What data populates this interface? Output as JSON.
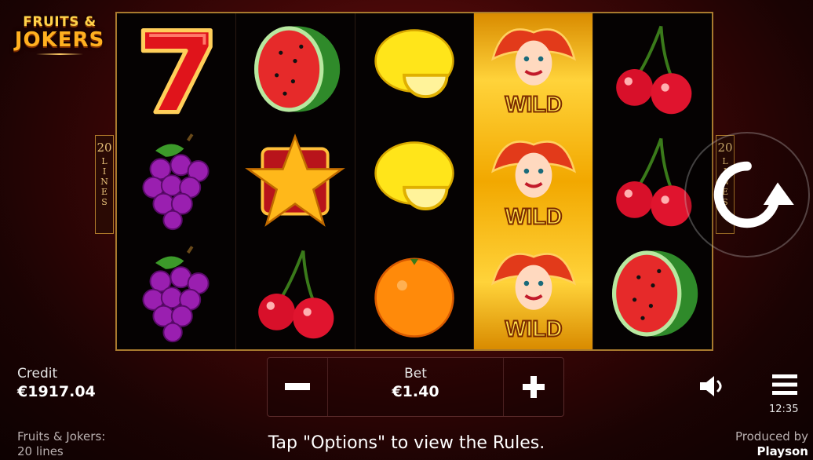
{
  "logo": {
    "line1": "FRUITS &",
    "line2": "JOKERS"
  },
  "paylines": {
    "count": "20",
    "label": [
      "L",
      "I",
      "N",
      "E",
      "S"
    ]
  },
  "reels": [
    [
      "seven",
      "watermelon-half",
      "",
      "",
      ""
    ],
    [
      "grapes",
      "star",
      "",
      ""
    ],
    [
      "grapes",
      "cherry",
      ""
    ]
  ],
  "reel_columns": [
    {
      "symbols": [
        "seven-icon",
        "grapes-icon",
        "grapes-icon"
      ]
    },
    {
      "symbols": [
        "watermelon-icon",
        "star-icon",
        "cherry-icon"
      ]
    },
    {
      "symbols": [
        "lemon-icon",
        "lemon-icon",
        "orange-icon"
      ]
    },
    {
      "symbols": [
        "joker-wild-icon",
        "joker-wild-icon",
        "joker-wild-icon"
      ],
      "wild_label": "WILD"
    },
    {
      "symbols": [
        "cherry-icon",
        "cherry-icon",
        "watermelon-icon"
      ]
    }
  ],
  "credit": {
    "label": "Credit",
    "value": "€1917.04"
  },
  "bet": {
    "label": "Bet",
    "value": "€1.40",
    "minus": "−",
    "plus": "+"
  },
  "clock": "12:35",
  "footer": {
    "game_name_line1": "Fruits & Jokers:",
    "game_name_line2": "20 lines",
    "tip": "Tap \"Options\" to view the Rules.",
    "producer_line1": "Produced by",
    "producer_line2": "Playson"
  },
  "colors": {
    "frame": "#a87a2e",
    "wild_bg": "#ffd33a",
    "background": "#3c0606"
  }
}
